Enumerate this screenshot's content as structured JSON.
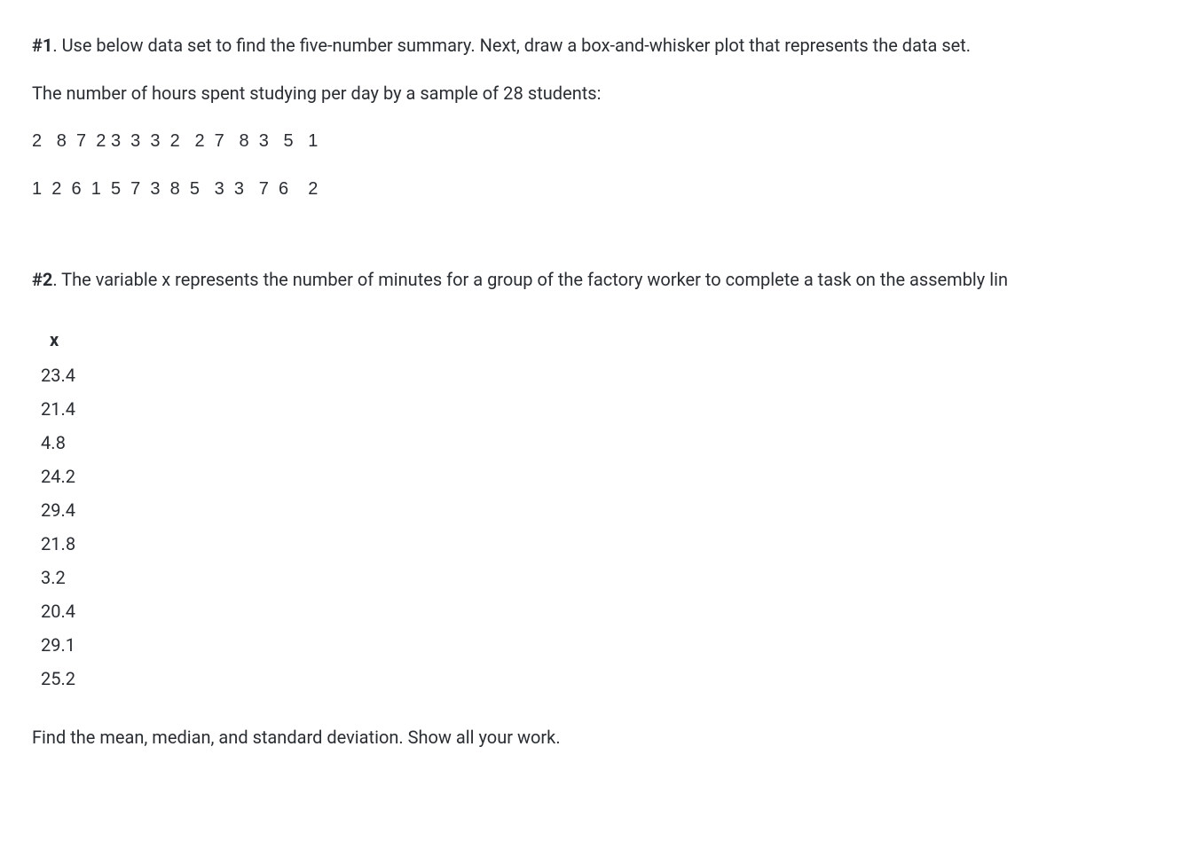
{
  "q1": {
    "label": "#1",
    "prompt": ". Use below data set to find the five-number summary. Next, draw a box-and-whisker plot that represents the data set.",
    "subprompt": "The number of hours spent studying per day by a sample of 28 students:",
    "data_row1": "2   8  7  2 3  3  3  2   2  7   8  3   5   1",
    "data_row2": "1  2  6  1  5  7  3  8  5   3  3   7  6    2"
  },
  "q2": {
    "label": "#2",
    "prompt": ". The variable x represents the number of minutes for a group of the factory worker to complete a task on the assembly lin",
    "table_header": "x",
    "table_values": [
      "23.4",
      "21.4",
      "4.8",
      "24.2",
      "29.4",
      "21.8",
      "3.2",
      "20.4",
      "29.1",
      "25.2"
    ],
    "final_line": "Find the mean, median, and standard deviation. Show all your work."
  }
}
